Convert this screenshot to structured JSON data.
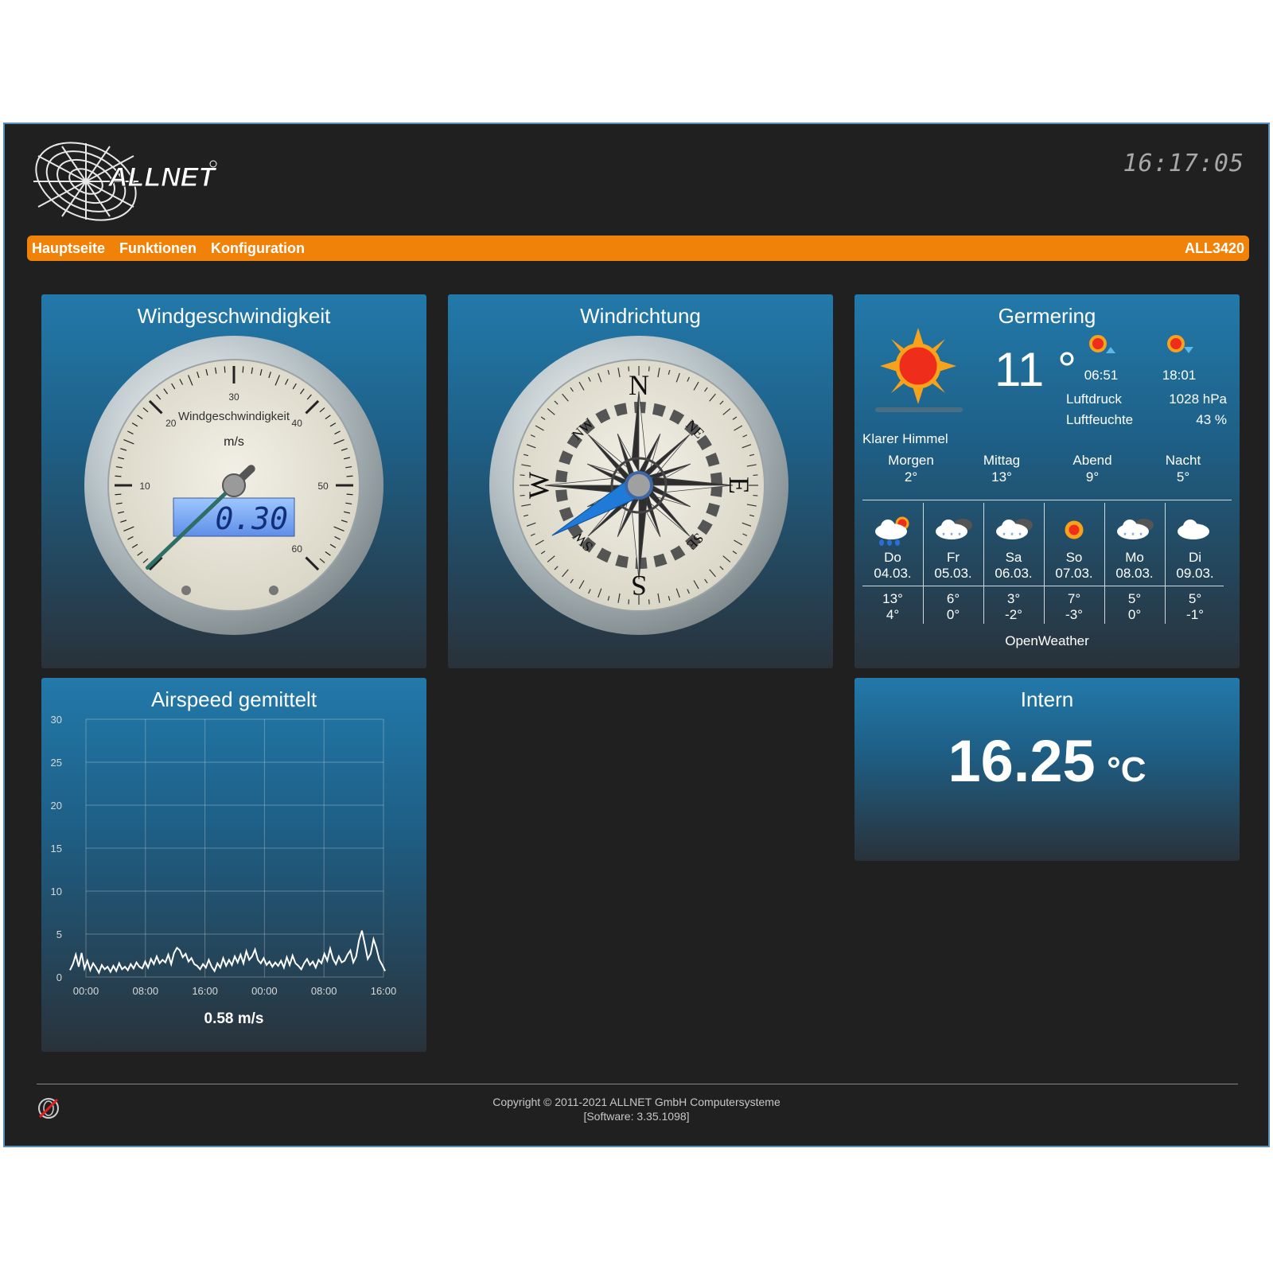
{
  "header": {
    "logo_text": "ALLNET",
    "clock": "16:17:05"
  },
  "nav": {
    "items": [
      "Hauptseite",
      "Funktionen",
      "Konfiguration"
    ],
    "model": "ALL3420"
  },
  "wind_speed": {
    "title": "Windgeschwindigkeit",
    "gauge_label": "Windgeschwindigkeit",
    "unit": "m/s",
    "ticks": [
      "10",
      "20",
      "30",
      "40",
      "50",
      "60"
    ],
    "display": "0.30",
    "value": 0.3,
    "max": 60
  },
  "wind_direction": {
    "title": "Windrichtung",
    "cardinals": [
      "N",
      "E",
      "S",
      "W"
    ],
    "intercardinals": [
      "NE",
      "SE",
      "SW",
      "NW"
    ],
    "direction_deg": 240
  },
  "weather": {
    "city": "Germering",
    "temp": "11 °",
    "sunrise": "06:51",
    "sunset": "18:01",
    "pressure_label": "Luftdruck",
    "pressure": "1028 hPa",
    "humidity_label": "Luftfeuchte",
    "humidity": "43 %",
    "condition": "Klarer Himmel",
    "dayparts": [
      {
        "label": "Morgen",
        "temp": "2°"
      },
      {
        "label": "Mittag",
        "temp": "13°"
      },
      {
        "label": "Abend",
        "temp": "9°"
      },
      {
        "label": "Nacht",
        "temp": "5°"
      }
    ],
    "forecast": [
      {
        "day": "Do",
        "date": "04.03.",
        "high": "13°",
        "low": "4°",
        "icon": "rain-sun-icon"
      },
      {
        "day": "Fr",
        "date": "05.03.",
        "high": "6°",
        "low": "0°",
        "icon": "snow-cloud-icon"
      },
      {
        "day": "Sa",
        "date": "06.03.",
        "high": "3°",
        "low": "-2°",
        "icon": "snow-cloud-icon"
      },
      {
        "day": "So",
        "date": "07.03.",
        "high": "7°",
        "low": "-3°",
        "icon": "sun-icon"
      },
      {
        "day": "Mo",
        "date": "08.03.",
        "high": "5°",
        "low": "0°",
        "icon": "snow-cloud-icon"
      },
      {
        "day": "Di",
        "date": "09.03.",
        "high": "5°",
        "low": "-1°",
        "icon": "cloud-icon"
      }
    ],
    "provider": "OpenWeather"
  },
  "chart_data": {
    "type": "line",
    "title": "Airspeed gemittelt",
    "x_ticks": [
      "00:00",
      "08:00",
      "16:00",
      "00:00",
      "08:00",
      "16:00"
    ],
    "y_ticks": [
      "0",
      "5",
      "10",
      "15",
      "20",
      "25",
      "30"
    ],
    "ylim": [
      0,
      30
    ],
    "grid": true,
    "series": [
      {
        "values": [
          0.8,
          1.5,
          2.6,
          1.2,
          2.8,
          1.0,
          1.9,
          0.8,
          1.6,
          1.1,
          0.5,
          1.4,
          0.9,
          1.2,
          0.6,
          1.3,
          0.7,
          1.6,
          0.9,
          1.2,
          0.8,
          1.5,
          1.0,
          1.7,
          1.2,
          1.0,
          1.8,
          1.1,
          2.1,
          1.5,
          2.4,
          1.6,
          2.0,
          1.7,
          2.6,
          1.5,
          2.8,
          3.4,
          3.1,
          2.3,
          2.7,
          1.8,
          2.2,
          1.5,
          1.3,
          0.9,
          1.5,
          1.1,
          2.0,
          1.2,
          0.7,
          1.6,
          1.1,
          2.2,
          1.3,
          2.0,
          1.4,
          2.4,
          1.7,
          2.6,
          1.6,
          3.0,
          2.0,
          2.4,
          3.2,
          2.0,
          1.6,
          2.2,
          1.4,
          1.8,
          1.2,
          1.7,
          1.3,
          1.9,
          1.1,
          2.3,
          1.4,
          2.5,
          1.6,
          1.3,
          0.9,
          1.6,
          2.1,
          1.4,
          1.8,
          1.1,
          2.0,
          1.6,
          2.7,
          1.9,
          3.3,
          2.1,
          1.5,
          2.4,
          1.7,
          1.9,
          2.6,
          3.1,
          1.7,
          2.4,
          4.3,
          5.4,
          3.8,
          2.1,
          2.7,
          4.4,
          3.4,
          2.0,
          1.4,
          0.7
        ]
      }
    ],
    "summary": "0.58 m/s"
  },
  "intern": {
    "title": "Intern",
    "value": "16.25",
    "unit": "°C"
  },
  "footer": {
    "copyright": "Copyright © 2011-2021 ALLNET GmbH Computersysteme",
    "software": "[Software: 3.35.1098]"
  }
}
